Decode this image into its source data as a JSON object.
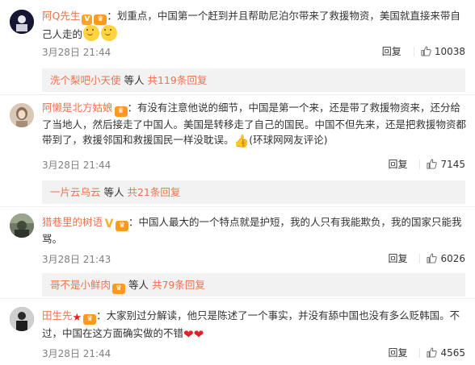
{
  "comments": [
    {
      "username": "阿Q先生",
      "text_main": "：划重点，中国第一个赶到并且帮助尼泊尔带来了救援物资，美国就直接来带自己人走的",
      "time": "3月28日 21:44",
      "reply_label": "回复",
      "likes": "10038",
      "subreply": {
        "user": "洗个梨吧小天使",
        "mid": " 等人 ",
        "more": "共119条回复"
      }
    },
    {
      "username": "阿懒是北方姑娘",
      "text_main": "：有没有注意他说的细节，中国是第一个来，还是带了救援物资来，还分给了当地人，然后接走了中国人。美国是转移走了自己的国民。中国不但先来，还是把救援物资都带到了，救援邻国和救援国民一样没耽误。",
      "text_tail": "(环球网网友评论)",
      "time": "3月28日 21:44",
      "reply_label": "回复",
      "likes": "7145",
      "subreply": {
        "user": "一片云乌云",
        "mid": " 等人 ",
        "more": "共21条回复"
      }
    },
    {
      "username": "猎巷里的树语",
      "text_main": "：中国人最大的一个特点就是护短，我的人只有我能欺负，我的国家只能我骂。",
      "time": "3月28日 21:43",
      "reply_label": "回复",
      "likes": "6026",
      "subreply": {
        "user": "哥不是小鲜肉",
        "mid": " 等人 ",
        "more": "共79条回复"
      }
    },
    {
      "username": "田生先",
      "text_main": "：大家别过分解读，他只是陈述了一个事实，并没有舔中国也没有多么贬韩国。不过，中国在这方面确实做的不错",
      "time": "3月28日 21:44",
      "reply_label": "回复",
      "likes": "4565"
    }
  ],
  "colors": {
    "link": "#eb7350",
    "meta": "#808080",
    "subreply_bg": "#f2f2f2"
  }
}
